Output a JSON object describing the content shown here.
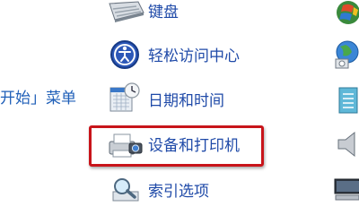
{
  "control_panel": {
    "left_column": {
      "start_menu_label": "开始」菜单"
    },
    "items": [
      {
        "label": "键盘",
        "icon": "keyboard-icon"
      },
      {
        "label": "轻松访问中心",
        "icon": "ease-of-access-icon"
      },
      {
        "label": "日期和时间",
        "icon": "calendar-clock-icon"
      },
      {
        "label": "设备和打印机",
        "icon": "printer-camera-icon",
        "highlighted": true
      },
      {
        "label": "索引选项",
        "icon": "index-magnifier-icon"
      }
    ],
    "right_column_icons": [
      "windows-globe-icon",
      "network-globe-icon",
      "notepad-icon",
      "speaker-icon",
      "display-icon"
    ]
  },
  "colors": {
    "link_blue": "#1f4aa8",
    "highlight_red": "#c8141a"
  }
}
